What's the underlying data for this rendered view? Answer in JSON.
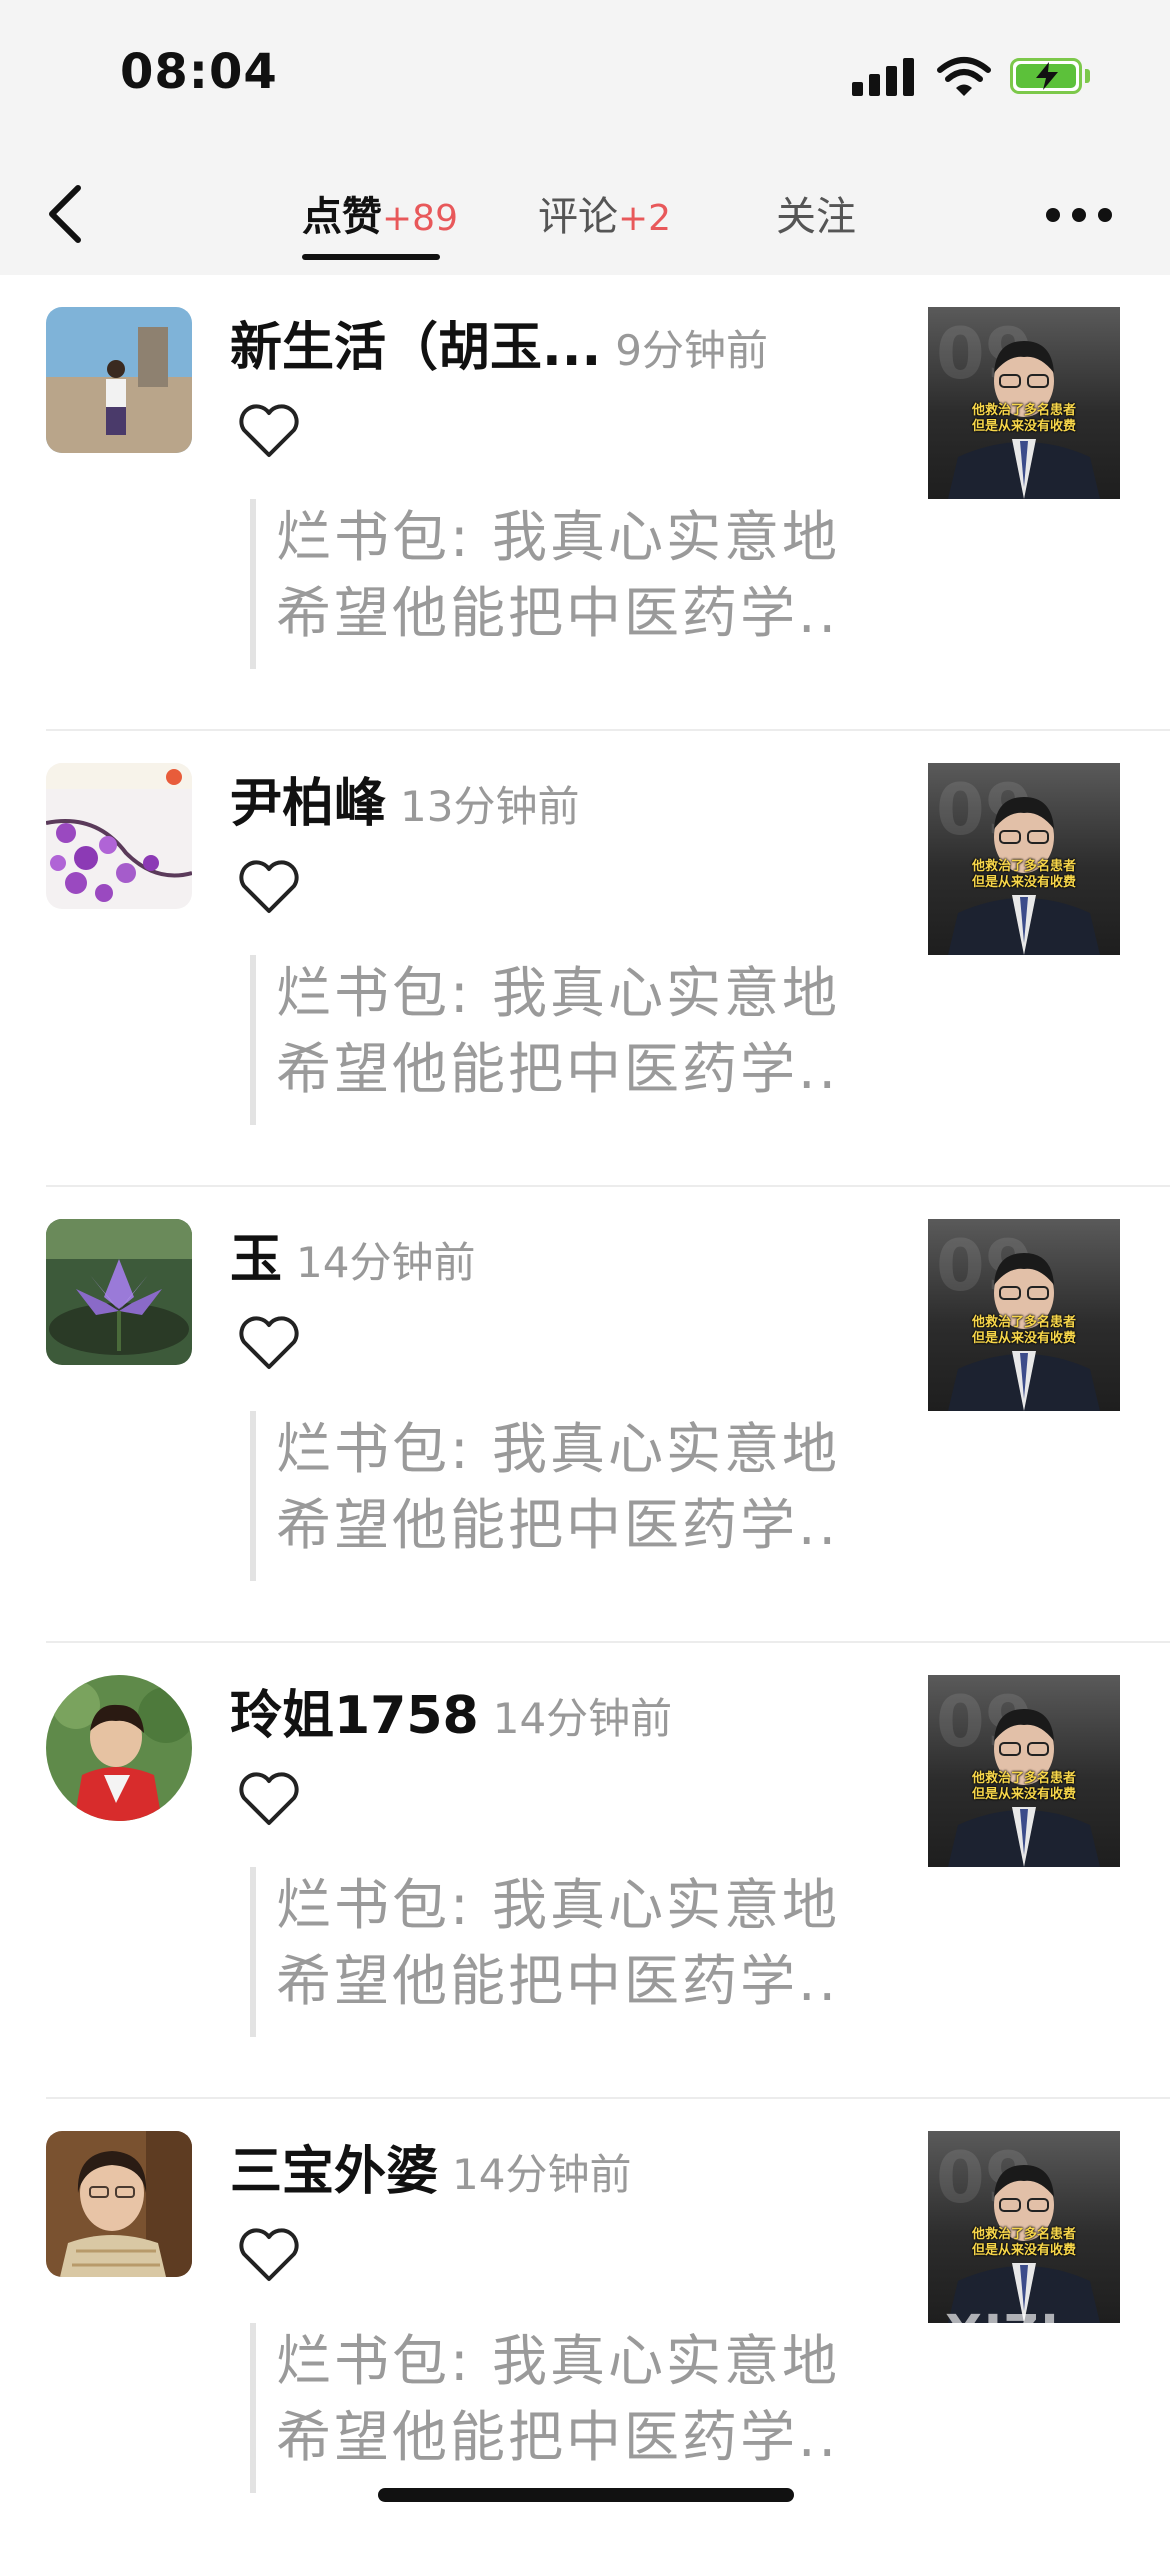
{
  "status_bar": {
    "time": "08:04"
  },
  "tabs": [
    {
      "label": "点赞",
      "count": "+89",
      "active": true
    },
    {
      "label": "评论",
      "count": "+2",
      "active": false
    },
    {
      "label": "关注",
      "count": "",
      "active": false
    }
  ],
  "items": [
    {
      "name": "新生活（胡玉...",
      "time": "9分钟前",
      "quote_line1": "烂书包: 我真心实意地",
      "quote_line2": "希望他能把中医药学..",
      "thumb_caption1": "他救治了多名患者",
      "thumb_caption2": "但是从来没有收费"
    },
    {
      "name": "尹柏峰",
      "time": "13分钟前",
      "quote_line1": "烂书包: 我真心实意地",
      "quote_line2": "希望他能把中医药学..",
      "thumb_caption1": "他救治了多名患者",
      "thumb_caption2": "但是从来没有收费"
    },
    {
      "name": "玉",
      "time": "14分钟前",
      "quote_line1": "烂书包: 我真心实意地",
      "quote_line2": "希望他能把中医药学..",
      "thumb_caption1": "他救治了多名患者",
      "thumb_caption2": "但是从来没有收费"
    },
    {
      "name": "玲姐1758",
      "time": "14分钟前",
      "quote_line1": "烂书包: 我真心实意地",
      "quote_line2": "希望他能把中医药学..",
      "thumb_caption1": "他救治了多名患者",
      "thumb_caption2": "但是从来没有收费"
    },
    {
      "name": "三宝外婆",
      "time": "14分钟前",
      "quote_line1": "烂书包: 我真心实意地",
      "quote_line2": "希望他能把中医药学..",
      "thumb_caption1": "他救治了多名患者",
      "thumb_caption2": "但是从来没有收费"
    }
  ],
  "watermark": "XIZI",
  "colors": {
    "accent_count": "#e8585a",
    "battery": "#5cc13a",
    "muted_text": "#9a9a9a"
  }
}
